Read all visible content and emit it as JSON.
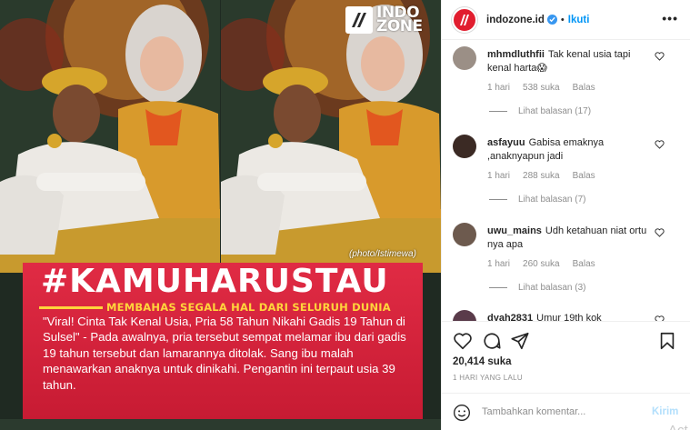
{
  "brand": {
    "logo_line1": "INDO",
    "logo_line2": "ZONE",
    "photo_credit": "(photo/Istimewa)"
  },
  "banner": {
    "hashtag": "#KAMUHARUSTAU",
    "tagline": "MEMBAHAS SEGALA HAL DARI SELURUH DUNIA",
    "body": "\"Viral! Cinta Tak Kenal Usia, Pria 58 Tahun Nikahi Gadis 19 Tahun di Sulsel\" - Pada awalnya, pria tersebut sempat melamar ibu dari gadis 19 tahun tersebut dan lamarannya ditolak. Sang ibu malah menawarkan anaknya untuk dinikahi. Pengantin ini terpaut usia 39 tahun."
  },
  "header": {
    "username": "indozone.id",
    "separator": "•",
    "follow_label": "Ikuti",
    "more_label": "•••"
  },
  "comments": [
    {
      "user": "mhmdluthfii",
      "text": "Tak kenal usia tapi kenal harta😱",
      "time": "1 hari",
      "likes": "538 suka",
      "reply": "Balas",
      "view_replies": "Lihat balasan (17)"
    },
    {
      "user": "asfayuu",
      "text": "Gabisa emaknya ,anaknyapun jadi",
      "time": "1 hari",
      "likes": "288 suka",
      "reply": "Balas",
      "view_replies": "Lihat balasan (7)"
    },
    {
      "user": "uwu_mains",
      "text": "Udh ketahuan niat ortu nya apa",
      "time": "1 hari",
      "likes": "260 suka",
      "reply": "Balas",
      "view_replies": "Lihat balasan (3)"
    },
    {
      "user": "dyah2831",
      "text": "Umur 19th kok"
    }
  ],
  "post": {
    "likes_count": "20,414 suka",
    "time_ago": "1 HARI YANG LALU",
    "comment_placeholder": "Tambahkan komentar...",
    "post_label": "Kirim",
    "watermark": "Act"
  },
  "colors": {
    "banner_red": "#d8213a",
    "tagline_yellow": "#ffd43b",
    "link_blue": "#0095f6",
    "verified_blue": "#3897f0",
    "muted_gray": "#8e8e8e"
  }
}
